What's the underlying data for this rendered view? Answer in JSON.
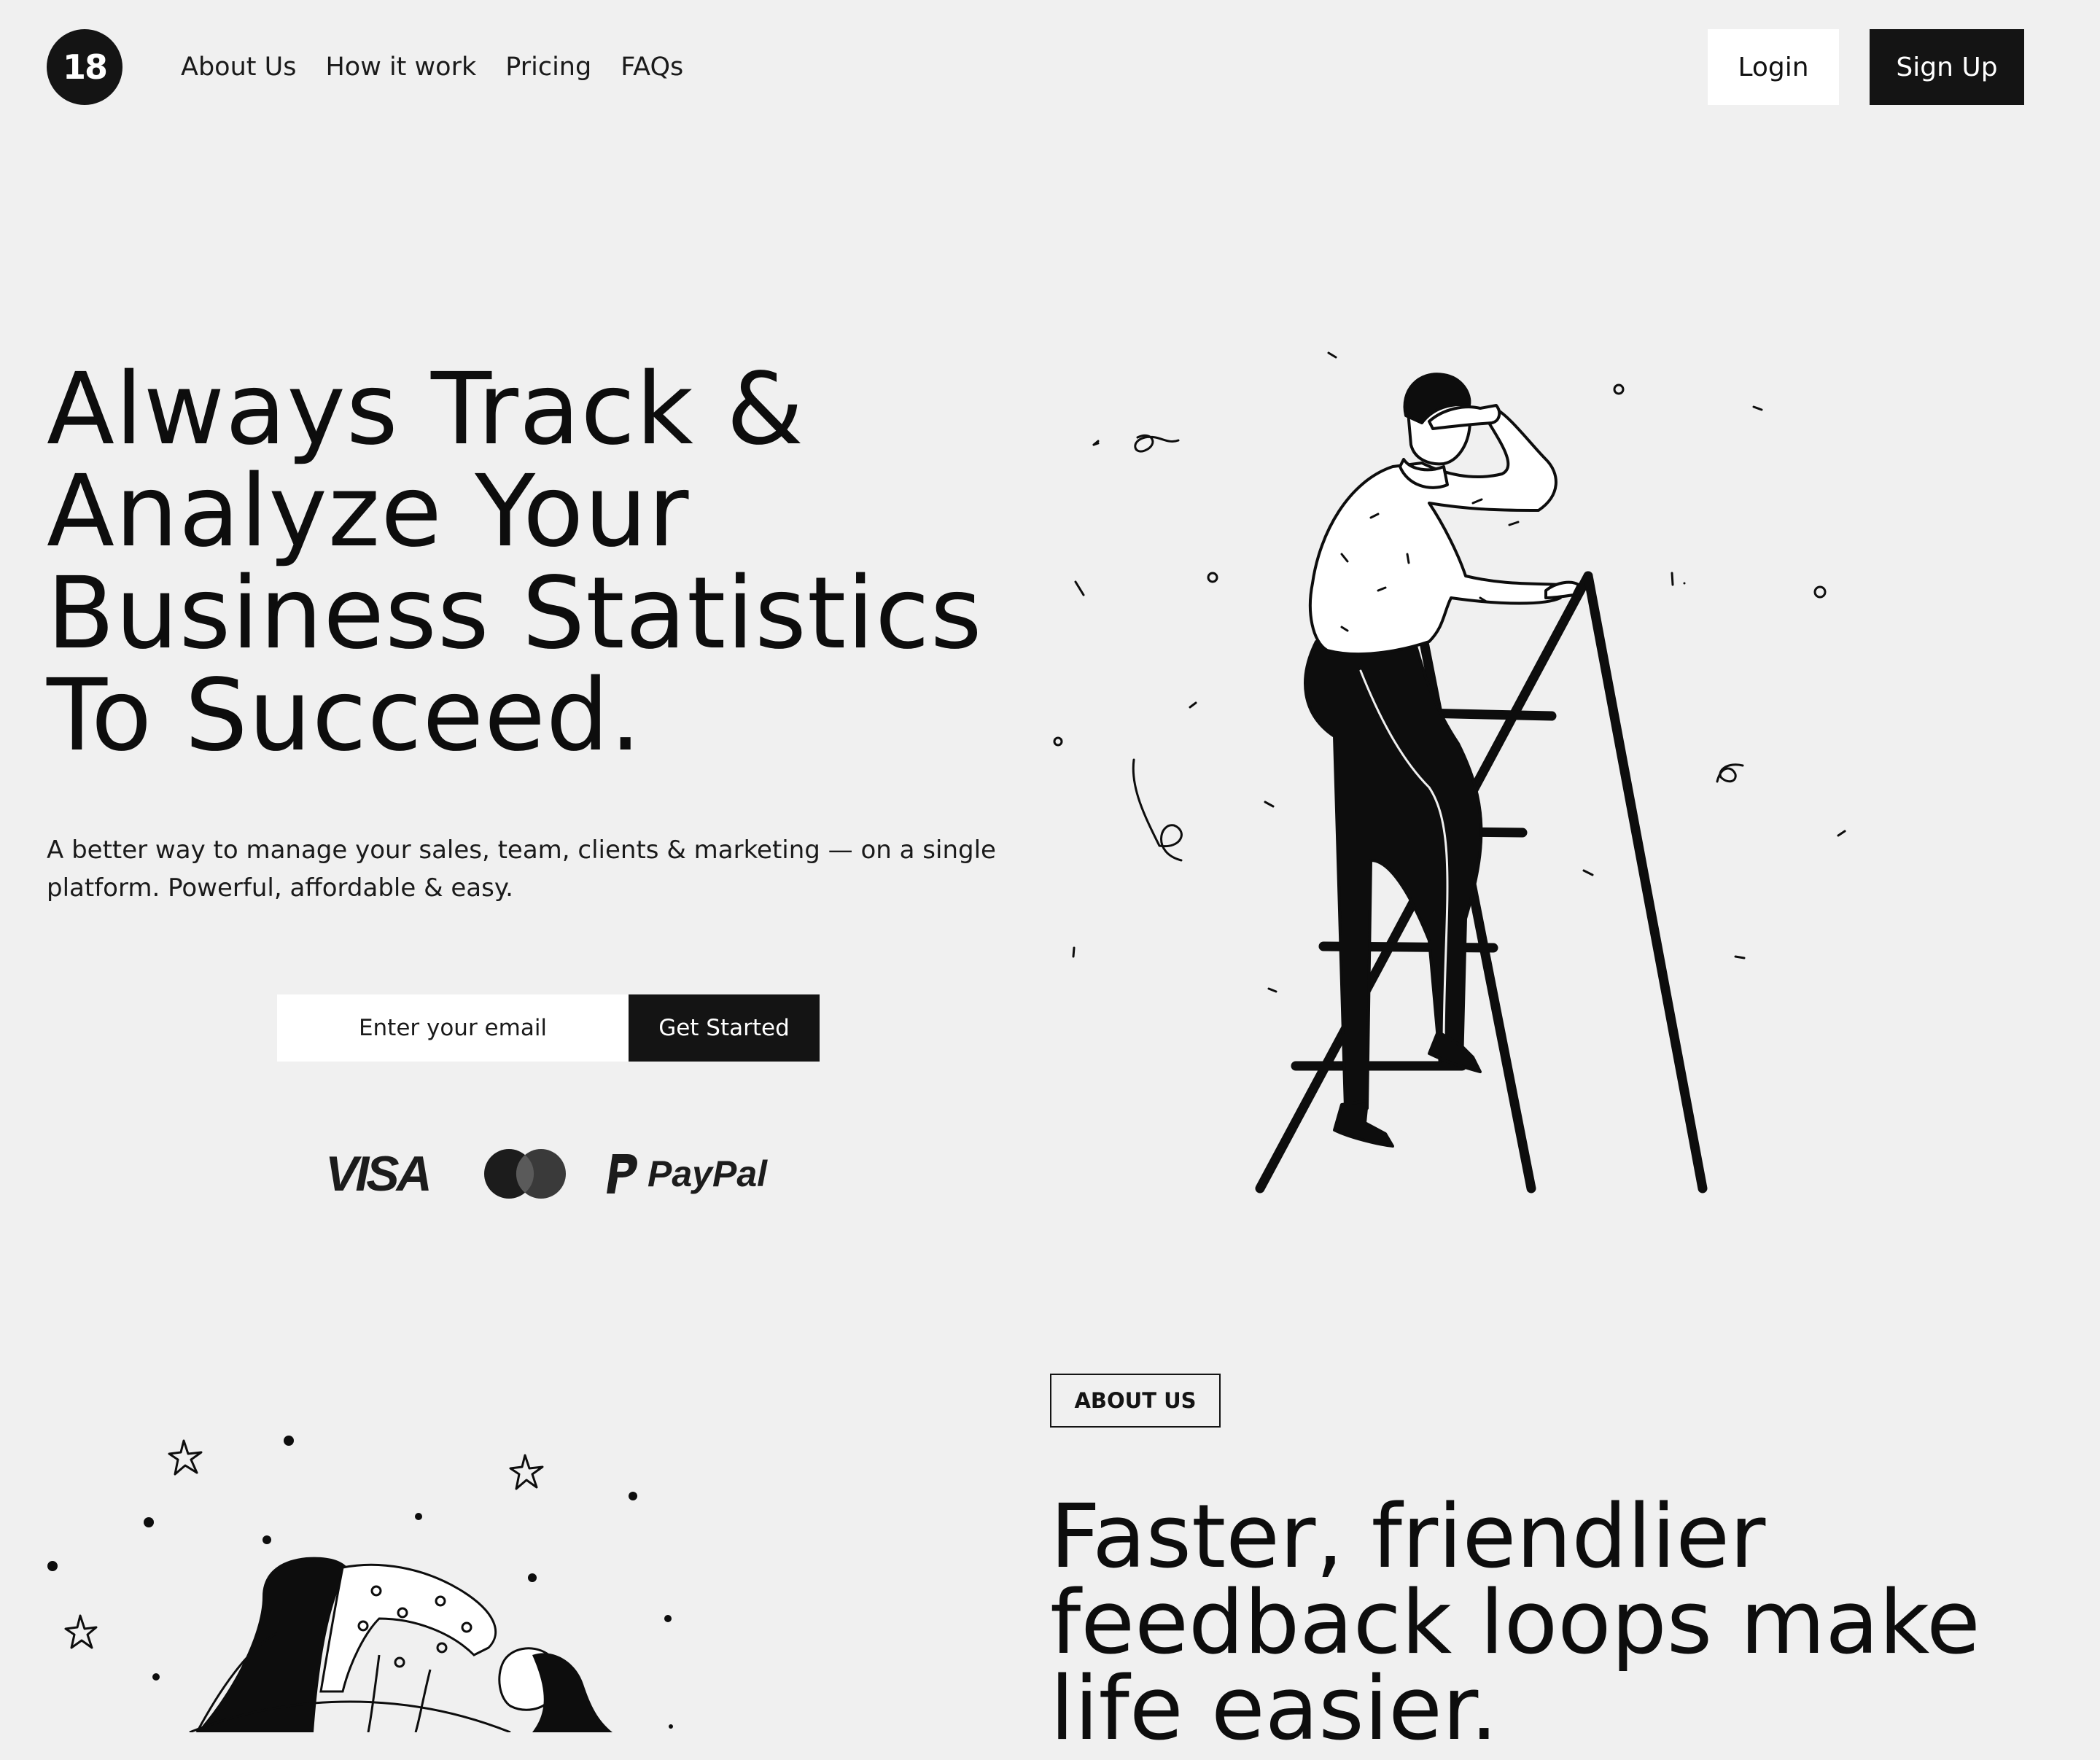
{
  "header": {
    "logo_text": "18",
    "nav": [
      "About Us",
      "How it work",
      "Pricing",
      "FAQs"
    ],
    "login_label": "Login",
    "signup_label": "Sign Up"
  },
  "hero": {
    "title_lines": [
      "Always Track &",
      "Analyze Your",
      "Business Statistics",
      "To Succeed."
    ],
    "subtitle": "A better way to manage your sales, team, clients & marketing — on a single platform. Powerful, affordable & easy.",
    "email_placeholder": "Enter your email",
    "cta_label": "Get Started",
    "payments": {
      "visa": "VISA",
      "mastercard_icon": "mastercard-logo",
      "paypal": "PayPal"
    },
    "illustration": "man-on-ladder-illustration"
  },
  "about": {
    "badge": "ABOUT US",
    "title": "Faster, friendlier feedback loops make life easier.",
    "illustration": "woman-bending-illustration"
  },
  "colors": {
    "background": "#f0f0f0",
    "primary": "#141414",
    "surface": "#ffffff"
  }
}
